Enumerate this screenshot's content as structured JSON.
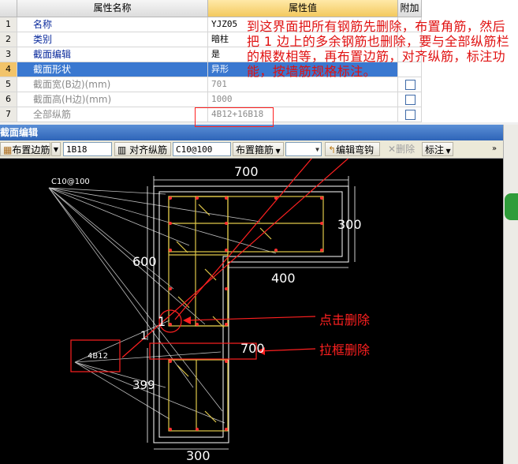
{
  "table": {
    "headers": {
      "name": "属性名称",
      "value": "属性值",
      "extra": "附加"
    },
    "rows": [
      {
        "idx": "1",
        "name": "名称",
        "value": "YJZ05"
      },
      {
        "idx": "2",
        "name": "类别",
        "value": "暗柱"
      },
      {
        "idx": "3",
        "name": "截面编辑",
        "value": "是"
      },
      {
        "idx": "4",
        "name": "截面形状",
        "value": "异形"
      },
      {
        "idx": "5",
        "name": "截面宽(B边)(mm)",
        "value": "701"
      },
      {
        "idx": "6",
        "name": "截面高(H边)(mm)",
        "value": "1000"
      },
      {
        "idx": "7",
        "name": "全部纵筋",
        "value": "4B12+16B18"
      }
    ]
  },
  "annotation": "到这界面把所有钢筋先删除，布置角筋，然后把 1 边上的多余钢筋也删除，要与全部纵筋栏的根数相等，再布置边筋，对齐纵筋，标注功能，按墙筋规格标注。",
  "editor": {
    "title": "截面编辑",
    "toolbar": {
      "side_rebar": "布置边筋",
      "side_rebar_value": "1B18",
      "align": "对齐纵筋",
      "stirrup_value": "C10@100",
      "stirrup": "布置箍筋",
      "edit_hook": "编辑弯钩",
      "delete": "删除",
      "label": "标注"
    },
    "drawing": {
      "dim_700_top": "700",
      "dim_300_right": "300",
      "dim_400": "400",
      "dim_600": "600",
      "label_1_a": "1",
      "label_1_b": "1",
      "dim_700_mid": "700",
      "dim_399": "399",
      "dim_300_bottom": "300",
      "stirrup_label": "C10@100",
      "rebar_label": "4B12",
      "callout_click": "点击删除",
      "callout_drag": "拉框删除"
    }
  }
}
